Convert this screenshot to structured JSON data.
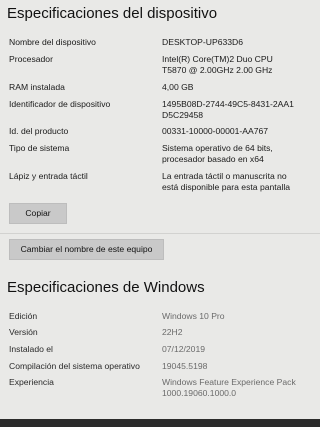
{
  "device_section": {
    "title": "Especificaciones del dispositivo",
    "rows": [
      {
        "label": "Nombre del dispositivo",
        "value": [
          "DESKTOP-UP633D6"
        ]
      },
      {
        "label": "Procesador",
        "value": [
          "Intel(R) Core(TM)2 Duo CPU",
          "T5870  @ 2.00GHz   2.00 GHz"
        ]
      },
      {
        "label": "RAM instalada",
        "value": [
          "4,00 GB"
        ]
      },
      {
        "label": "Identificador de dispositivo",
        "value": [
          "1495B08D-2744-49C5-8431-2AA1",
          "D5C29458"
        ]
      },
      {
        "label": "Id. del producto",
        "value": [
          "00331-10000-00001-AA767"
        ]
      },
      {
        "label": "Tipo de sistema",
        "value": [
          "Sistema operativo de 64 bits,",
          "procesador basado en x64"
        ]
      },
      {
        "label": "Lápiz y entrada táctil",
        "value": [
          "La entrada táctil o manuscrita no",
          "está disponible para esta pantalla"
        ]
      }
    ],
    "copy_button": "Copiar",
    "rename_button": "Cambiar el nombre de este equipo"
  },
  "windows_section": {
    "title": "Especificaciones de Windows",
    "rows": [
      {
        "label": "Edición",
        "value": [
          "Windows 10 Pro"
        ]
      },
      {
        "label": "Versión",
        "value": [
          "22H2"
        ]
      },
      {
        "label": "Instalado el",
        "value": [
          "07/12/2019"
        ]
      },
      {
        "label": "Compilación del sistema operativo",
        "value": [
          "19045.5198"
        ]
      },
      {
        "label": "Experiencia",
        "value": [
          "Windows Feature Experience Pack",
          "1000.19060.1000.0"
        ]
      }
    ]
  }
}
